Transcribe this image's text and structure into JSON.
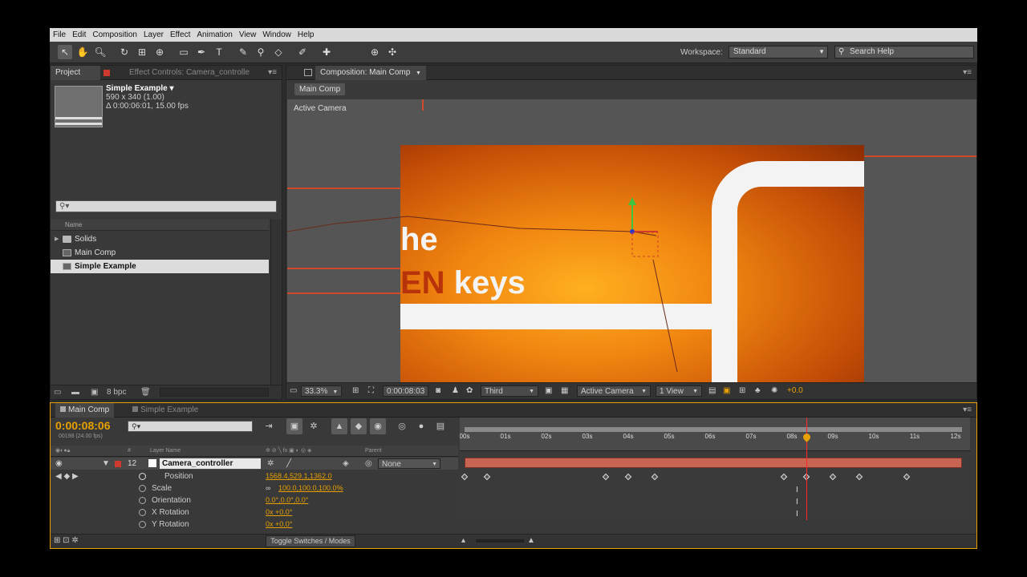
{
  "menu": [
    "File",
    "Edit",
    "Composition",
    "Layer",
    "Effect",
    "Animation",
    "View",
    "Window",
    "Help"
  ],
  "toolbar": {
    "workspace_label": "Workspace:",
    "workspace_value": "Standard",
    "search_placeholder": "Search Help"
  },
  "project": {
    "tab_project": "Project",
    "tab_effects": "Effect Controls: Camera_controlle",
    "selected_name": "Simple Example ▾",
    "dimensions": "590 x 340 (1.00)",
    "duration": "Δ 0:00:06:01, 15.00 fps",
    "search_placeholder": "",
    "column_name": "Name",
    "items": [
      {
        "label": "Solids",
        "type": "folder"
      },
      {
        "label": "Main Comp",
        "type": "comp"
      },
      {
        "label": "Simple Example",
        "type": "comp",
        "selected": true
      }
    ],
    "bpc": "8 bpc"
  },
  "composition": {
    "tab": "Composition: Main Comp",
    "subtab": "Main Comp",
    "view_label": "Active Camera",
    "frame_text_line1": "he",
    "frame_text_em": "EN",
    "frame_text_line2": "keys",
    "footer": {
      "zoom": "33.3%",
      "time": "0:00:08:03",
      "resolution": "Third",
      "camera": "Active Camera",
      "views": "1 View",
      "exposure": "+0.0"
    }
  },
  "timeline": {
    "tab_main": "Main Comp",
    "tab_simple": "Simple Example",
    "current_time": "0:00:08:06",
    "frame_info": "00198 (24.00 fps)",
    "col_layer_name": "Layer Name",
    "col_parent": "Parent",
    "layer": {
      "number": "12",
      "name": "Camera_controller",
      "parent": "None"
    },
    "properties": [
      {
        "name": "Position",
        "value": "1568.4,529.1,1362.0"
      },
      {
        "name": "Scale",
        "value": "100.0,100.0,100.0%"
      },
      {
        "name": "Orientation",
        "value": "0.0°,0.0°,0.0°"
      },
      {
        "name": "X Rotation",
        "value": "0x +0.0°"
      },
      {
        "name": "Y Rotation",
        "value": "0x +0.0°"
      }
    ],
    "ruler_ticks": [
      "00s",
      "01s",
      "02s",
      "03s",
      "04s",
      "05s",
      "06s",
      "07s",
      "08s",
      "09s",
      "10s",
      "11s",
      "12s"
    ],
    "toggle_label": "Toggle Switches / Modes",
    "colors": {
      "time": "#e8a000",
      "layer_bar": "#c86452",
      "cti": "#ff2a2a"
    }
  }
}
